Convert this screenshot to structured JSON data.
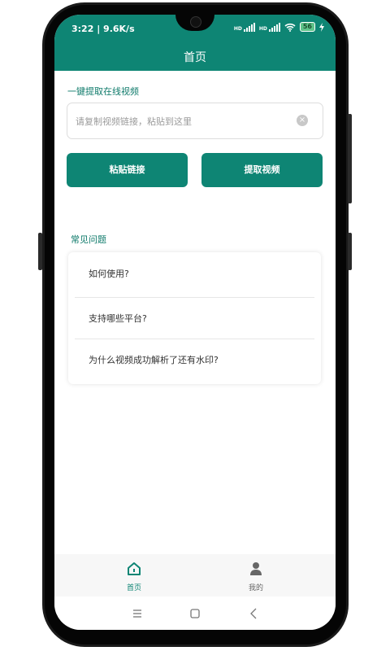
{
  "status_bar": {
    "time": "3:22 | 9.6K/s",
    "signal1_label": "HD",
    "signal2_label": "HD",
    "battery": "56"
  },
  "app_bar": {
    "title": "首页"
  },
  "extract": {
    "section_title": "一键提取在线视频",
    "input_placeholder": "请复制视频链接，粘贴到这里",
    "paste_button": "粘贴链接",
    "extract_button": "提取视频"
  },
  "faq": {
    "section_title": "常见问题",
    "items": [
      "如何使用?",
      "支持哪些平台?",
      "为什么视频成功解析了还有水印?"
    ]
  },
  "bottom_nav": {
    "items": [
      {
        "label": "首页",
        "icon": "home-icon",
        "active": true
      },
      {
        "label": "我的",
        "icon": "person-icon",
        "active": false
      }
    ]
  },
  "colors": {
    "primary": "#0e8574",
    "accent_text": "#0e7a6a",
    "inactive": "#666666"
  }
}
